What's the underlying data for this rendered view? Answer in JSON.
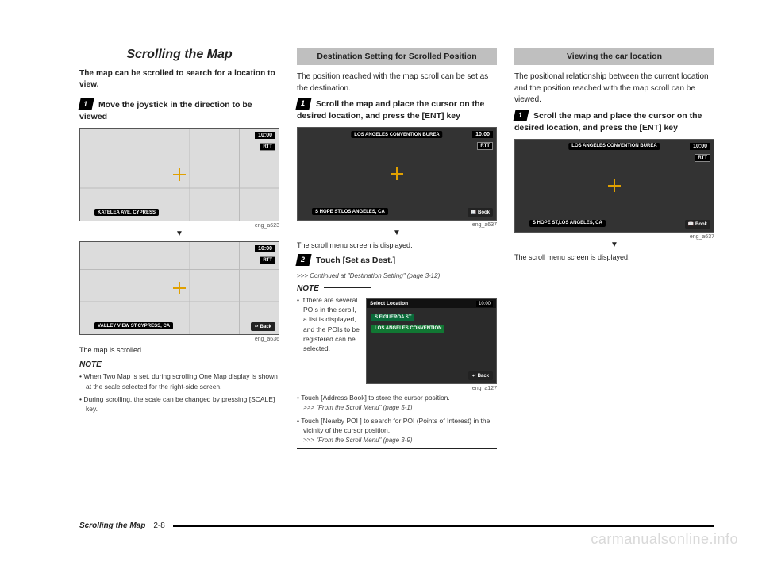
{
  "page": {
    "footer_section": "Scrolling the Map",
    "footer_page": "2-8",
    "watermark": "carmanualsonline.info"
  },
  "col1": {
    "title": "Scrolling the Map",
    "lead": "The map can be scrolled to search for a location to view.",
    "step1_badge": "1",
    "step1_text": "Move the joystick in the direction to be viewed",
    "shot1": {
      "time": "10:00",
      "rtt": "RTT",
      "street": "KATELEA AVE, CYPRESS",
      "caption": "eng_a623"
    },
    "arrow": "▼",
    "shot2": {
      "time": "10:00",
      "rtt": "RTT",
      "street": "VALLEY VIEW ST,CYPRESS, CA",
      "back": "↵ Back",
      "caption": "eng_a636"
    },
    "scrolled_text": "The map is scrolled.",
    "note_head": "NOTE",
    "notes": [
      "When Two Map is set, during scrolling One Map display is shown at the scale selected for the right-side screen.",
      "During scrolling, the scale can be changed by pressing [SCALE] key."
    ]
  },
  "col2": {
    "header": "Destination Setting for Scrolled Position",
    "lead": "The position reached with the map scroll can be set as the destination.",
    "step1_badge": "1",
    "step1_text": "Scroll the map and place the cursor on the desired location, and press the [ENT] key",
    "shot1": {
      "top_label": "LOS ANGELES CONVENTION BUREA",
      "time": "10:00",
      "rtt": "RTT",
      "street": "S HOPE ST,LOS ANGELES, CA",
      "book": "📖 Book",
      "caption": "eng_a637"
    },
    "arrow": "▼",
    "scroll_menu_text": "The scroll menu screen is displayed.",
    "step2_badge": "2",
    "step2_text": "Touch [Set as Dest.]",
    "continued": ">>> Continued at \"Destination Setting\" (page 3-12)",
    "note_head": "NOTE",
    "note1": "If there are several POIs in the scroll, a list is displayed, and the POIs to be registered can be selected.",
    "shot2": {
      "header": "Select Location",
      "row1": "S FIGUEROA ST",
      "row2": "LOS ANGELES CONVENTION",
      "time": "10:00",
      "back": "↵ Back",
      "caption": "eng_a127"
    },
    "notes_tail": [
      {
        "text": "Touch [Address Book] to store the cursor position.",
        "ref": ">>> \"From the Scroll Menu\" (page 5-1)"
      },
      {
        "text": "Touch [Nearby POI ] to search for POI (Points of Interest) in the vicinity of the cursor position.",
        "ref": ">>> \"From the Scroll Menu\" (page 3-9)"
      }
    ]
  },
  "col3": {
    "header": "Viewing the car location",
    "lead": "The positional relationship between the current location and the position reached with the map scroll can be viewed.",
    "step1_badge": "1",
    "step1_text": "Scroll the map and place the cursor on the desired location, and press the [ENT] key",
    "shot1": {
      "top_label": "LOS ANGELES CONVENTION BUREA",
      "time": "10:00",
      "rtt": "RTT",
      "street": "S HOPE ST,LOS ANGELES, CA",
      "book": "📖 Book",
      "caption": "eng_a637"
    },
    "arrow": "▼",
    "scroll_menu_text": "The scroll menu screen is displayed."
  }
}
